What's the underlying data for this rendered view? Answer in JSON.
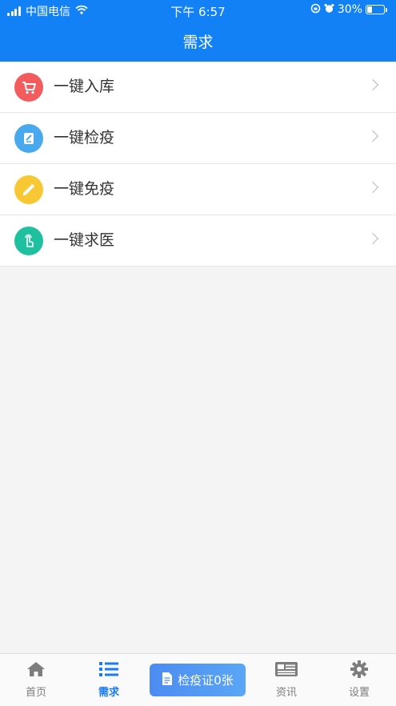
{
  "status_bar": {
    "carrier": "中国电信",
    "time": "下午 6:57",
    "battery_percent": "30%",
    "battery_level": 0.3
  },
  "header": {
    "title": "需求"
  },
  "menu": {
    "items": [
      {
        "label": "一键入库",
        "icon": "cart-icon",
        "color": "#f25c5c"
      },
      {
        "label": "一键检疫",
        "icon": "edit-note-icon",
        "color": "#49a9ef"
      },
      {
        "label": "一键免疫",
        "icon": "syringe-icon",
        "color": "#f7c734"
      },
      {
        "label": "一键求医",
        "icon": "hand-tap-icon",
        "color": "#1ec0a0"
      }
    ]
  },
  "tabbar": {
    "home_label": "首页",
    "needs_label": "需求",
    "certificate_label": "检疫证0张",
    "news_label": "资讯",
    "settings_label": "设置",
    "active_color": "#1a7cf2",
    "inactive_color": "#7d7d7d"
  }
}
